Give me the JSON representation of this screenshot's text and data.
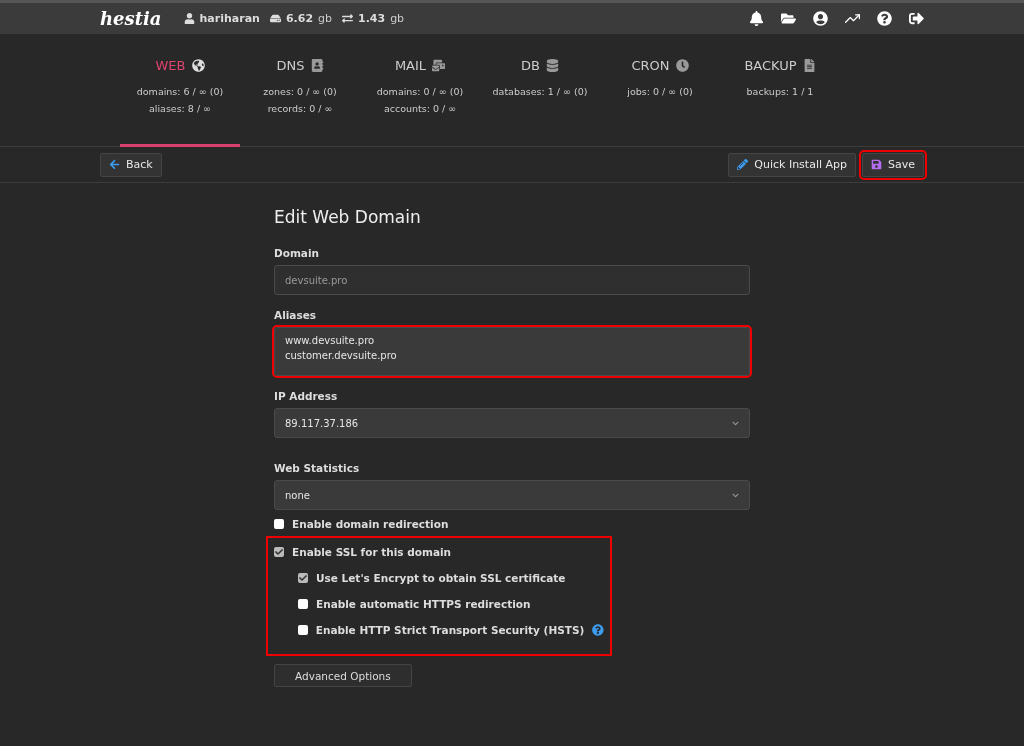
{
  "top_bar": {
    "logo": "hestia",
    "user": "hariharan",
    "disk": "6.62",
    "disk_unit": "gb",
    "bandwidth": "1.43",
    "bandwidth_unit": "gb"
  },
  "tabs": [
    {
      "label": "WEB",
      "selected": true,
      "stats": [
        "domains: 6 / ∞ (0)",
        "aliases: 8 / ∞"
      ]
    },
    {
      "label": "DNS",
      "selected": false,
      "stats": [
        "zones: 0 / ∞ (0)",
        "records: 0 / ∞"
      ]
    },
    {
      "label": "MAIL",
      "selected": false,
      "stats": [
        "domains: 0 / ∞ (0)",
        "accounts: 0 / ∞"
      ]
    },
    {
      "label": "DB",
      "selected": false,
      "stats": [
        "databases: 1 / ∞ (0)"
      ]
    },
    {
      "label": "CRON",
      "selected": false,
      "stats": [
        "jobs: 0 / ∞ (0)"
      ]
    },
    {
      "label": "BACKUP",
      "selected": false,
      "stats": [
        "backups: 1 / 1"
      ]
    }
  ],
  "toolbar": {
    "back": "Back",
    "quick_install": "Quick Install App",
    "save": {
      "label": "Save",
      "highlighted": true
    }
  },
  "form": {
    "title": "Edit Web Domain",
    "fields": [
      {
        "kind": "input",
        "label": "Domain",
        "value": "devsuite.pro",
        "disabled": true,
        "highlighted": false
      },
      {
        "kind": "textarea",
        "label": "Aliases",
        "value": "www.devsuite.pro\ncustomer.devsuite.pro",
        "disabled": false,
        "highlighted": true
      },
      {
        "kind": "select",
        "label": "IP Address",
        "value": "89.117.37.186",
        "disabled": false,
        "highlighted": false
      },
      {
        "kind": "select",
        "label": "Web Statistics",
        "value": "none",
        "disabled": false,
        "highlighted": false
      }
    ],
    "redirection": {
      "label": "Enable domain redirection",
      "checked": false
    },
    "ssl": {
      "label": "Enable SSL for this domain",
      "checked": true,
      "highlighted": true,
      "options": [
        {
          "label": "Use Let's Encrypt to obtain SSL certificate",
          "checked": true,
          "help": false
        },
        {
          "label": "Enable automatic HTTPS redirection",
          "checked": false,
          "help": false
        },
        {
          "label": "Enable HTTP Strict Transport Security (HSTS)",
          "checked": false,
          "help": true
        }
      ]
    },
    "advanced": "Advanced Options"
  }
}
